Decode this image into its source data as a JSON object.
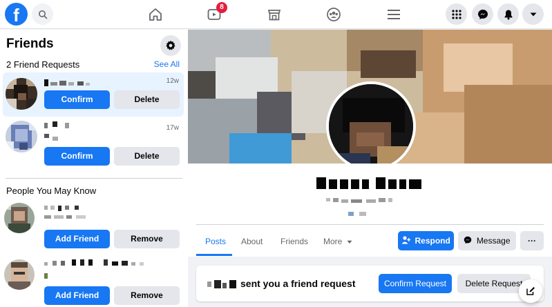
{
  "nav": {
    "logo_letter": "f",
    "watch_badge": "8",
    "icons": [
      "home-icon",
      "watch-icon",
      "marketplace-icon",
      "groups-icon",
      "menu-icon",
      "apps-grid-icon",
      "messenger-icon",
      "notifications-icon",
      "account-caret-icon"
    ],
    "accent": "#1877f2"
  },
  "sidebar": {
    "title": "Friends",
    "requests_header": "2 Friend Requests",
    "see_all": "See All",
    "requests": [
      {
        "time": "12w",
        "confirm": "Confirm",
        "delete": "Delete"
      },
      {
        "time": "17w",
        "confirm": "Confirm",
        "delete": "Delete"
      }
    ],
    "pymk_header": "People You May Know",
    "suggestions": [
      {
        "add": "Add Friend",
        "remove": "Remove"
      },
      {
        "add": "Add Friend",
        "remove": "Remove"
      }
    ]
  },
  "profile": {
    "tabs": [
      "Posts",
      "About",
      "Friends",
      "More"
    ],
    "respond": "Respond",
    "message": "Message",
    "more_actions": "···"
  },
  "notice": {
    "text": "sent you a friend request",
    "confirm": "Confirm Request",
    "delete": "Delete Request"
  }
}
